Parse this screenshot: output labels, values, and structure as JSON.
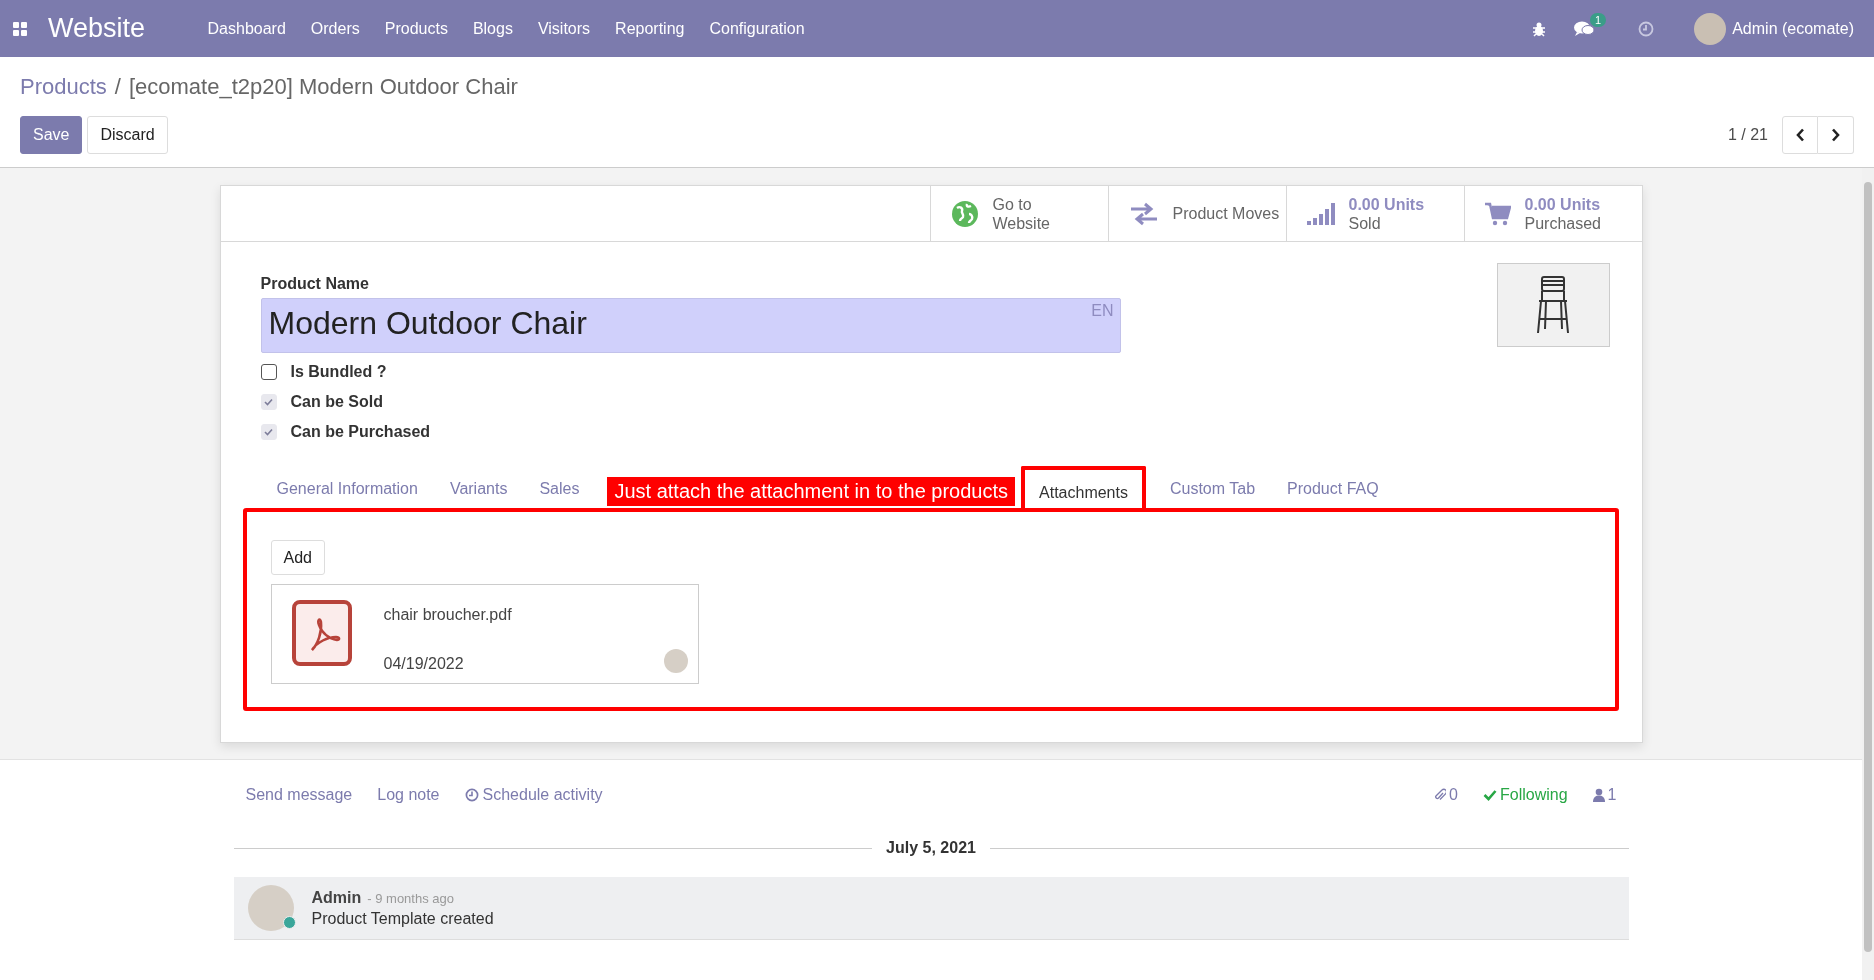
{
  "navbar": {
    "brand": "Website",
    "menu": [
      "Dashboard",
      "Orders",
      "Products",
      "Blogs",
      "Visitors",
      "Reporting",
      "Configuration"
    ],
    "message_count": "1",
    "user": "Admin (ecomate)"
  },
  "breadcrumb_separator": "/",
  "breadcrumb": [
    {
      "label": "Products",
      "kind": "link"
    },
    {
      "label": "[ecomate_t2p20] Modern Outdoor Chair",
      "kind": "current"
    }
  ],
  "buttons": [
    {
      "label": "Save",
      "kind": "primary"
    },
    {
      "label": "Discard",
      "kind": "secondary"
    }
  ],
  "pager": "1 / 21",
  "stat_buttons": [
    {
      "kind": "globe",
      "label": "Go to Website"
    },
    {
      "kind": "moves",
      "label": "Product Moves"
    },
    {
      "kind": "sold",
      "value": "0.00 Units",
      "label": "Sold"
    },
    {
      "kind": "purchased",
      "value": "0.00 Units",
      "label": "Purchased"
    }
  ],
  "product_name": {
    "label": "Product Name",
    "value": "Modern Outdoor Chair",
    "lang": "EN"
  },
  "checkboxes": [
    {
      "label": "Is Bundled ?",
      "checked": false
    },
    {
      "label": "Can be Sold",
      "checked": true
    },
    {
      "label": "Can be Purchased",
      "checked": true
    }
  ],
  "tabs": [
    {
      "label": "General Information",
      "selected": false
    },
    {
      "label": "Variants",
      "selected": false
    },
    {
      "label": "Sales",
      "selected": false
    },
    {
      "label": "Attachments",
      "selected": true
    },
    {
      "label": "Custom Tab",
      "selected": false
    },
    {
      "label": "Product FAQ",
      "selected": false
    }
  ],
  "annotation": {
    "text": "Just attach the attachment in to the products"
  },
  "attachments": {
    "add_button": "Add",
    "files": [
      {
        "name": "chair broucher.pdf",
        "date": "04/19/2022"
      }
    ]
  },
  "chatter": {
    "actions": [
      "Send message",
      "Log note",
      "Schedule activity"
    ],
    "attachment_count": "0",
    "follow": "Following",
    "follower_count": "1",
    "date": "July 5, 2021",
    "messages": [
      {
        "author": "Admin",
        "time": "- 9 months ago",
        "body": "Product Template created"
      }
    ]
  }
}
